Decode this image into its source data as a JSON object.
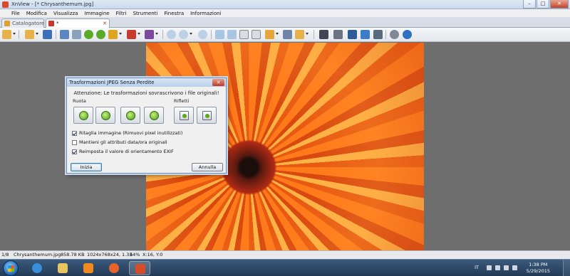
{
  "window": {
    "title": "XnView - [* Chrysanthemum.jpg]",
    "controls": {
      "minimize": "–",
      "maximize": "□",
      "close": "✕"
    }
  },
  "menu": [
    "File",
    "Modifica",
    "Visualizza",
    "Immagine",
    "Filtri",
    "Strumenti",
    "Finestra",
    "Informazioni"
  ],
  "tabs": [
    {
      "label": "Catalogatore"
    },
    {
      "label": "* Chrysanthemum.jpg",
      "close": "✕"
    }
  ],
  "dialog": {
    "title": "Trasformazioni JPEG Senza Perdite",
    "close": "✕",
    "warning": "Attenzione: Le trasformazioni sovrascrivono i file originali!",
    "rotate_label": "Ruota",
    "flip_label": "Rifletti",
    "options": [
      {
        "label": "Ritaglia immagine (Rimuovi pixel inutilizzati)",
        "checked": true
      },
      {
        "label": "Mantieni gli attributi data/ora originali",
        "checked": false
      },
      {
        "label": "Reimposta il valore di orientamento EXIF",
        "checked": true
      }
    ],
    "start_button": "Inizia",
    "cancel_button": "Annulla"
  },
  "status": {
    "index": "1/8",
    "filename": "Chrysanthemum.jpg",
    "filesize": "858.78 KB",
    "dimensions": "1024x768x24, 1.33",
    "zoom": "64%",
    "coords": "X:16, Y:0"
  },
  "taskbar": {
    "language": "IT",
    "time": "1:38 PM",
    "date": "5/29/2015"
  }
}
